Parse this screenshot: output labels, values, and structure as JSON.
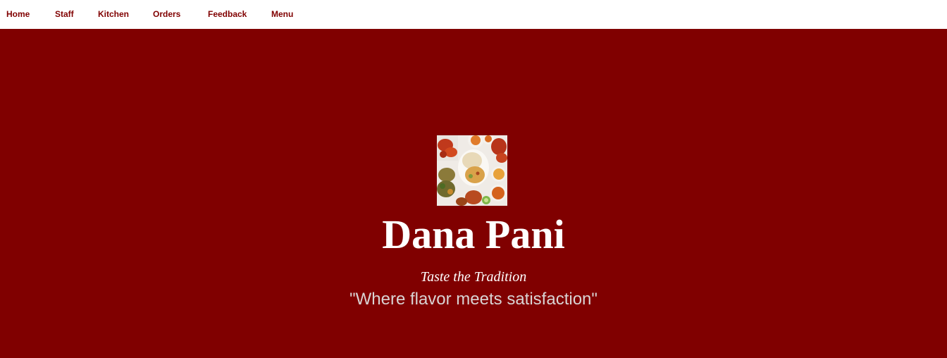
{
  "nav": {
    "items": [
      {
        "label": "Home"
      },
      {
        "label": "Staff"
      },
      {
        "label": "Kitchen"
      },
      {
        "label": "Orders"
      },
      {
        "label": "Feedback"
      },
      {
        "label": "Menu"
      }
    ]
  },
  "hero": {
    "title": "Dana Pani",
    "tagline": "Taste the Tradition",
    "quote": "\"Where flavor meets satisfaction\""
  },
  "colors": {
    "brand": "#800000",
    "nav_background": "#ffffff",
    "hero_text": "#ffffff",
    "quote_text": "#d9d4d4"
  }
}
